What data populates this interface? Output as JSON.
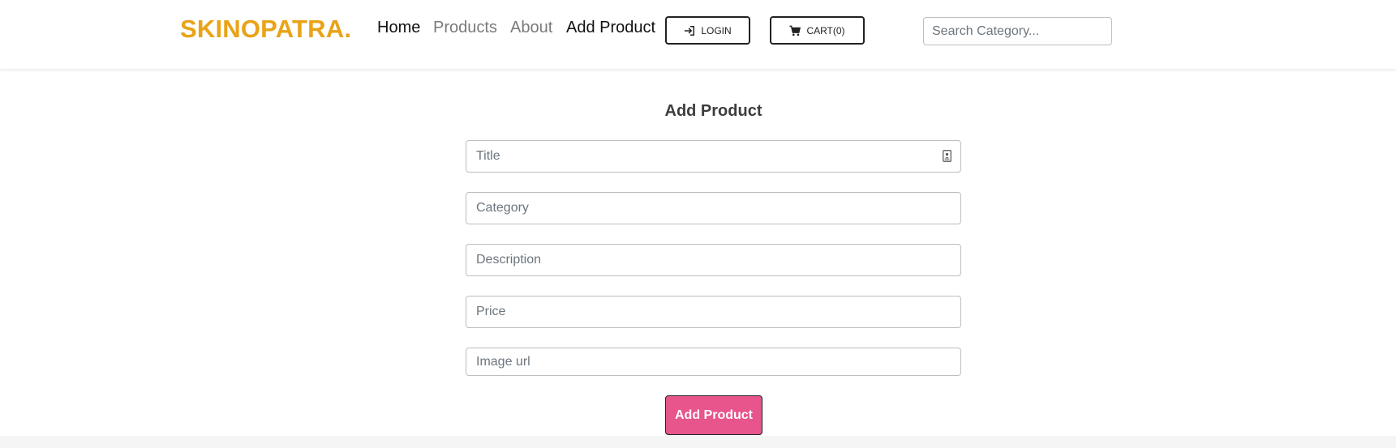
{
  "navbar": {
    "brand": "SKINOPATRA.",
    "links": [
      {
        "label": "Home",
        "active": true
      },
      {
        "label": "Products",
        "active": false
      },
      {
        "label": "About",
        "active": false
      },
      {
        "label": "Add Product",
        "active": true
      }
    ],
    "login_label": "LOGIN",
    "login_icon": "sign-in-icon",
    "cart_label": "CART(0)",
    "cart_icon": "cart-icon",
    "search_placeholder": "Search Category..."
  },
  "form": {
    "title": "Add Product",
    "fields": {
      "title": {
        "placeholder": "Title",
        "value": ""
      },
      "category": {
        "placeholder": "Category",
        "value": ""
      },
      "description": {
        "placeholder": "Description",
        "value": ""
      },
      "price": {
        "placeholder": "Price",
        "value": ""
      },
      "image_url": {
        "placeholder": "Image url",
        "value": ""
      }
    },
    "submit_label": "Add Product"
  },
  "colors": {
    "brand": "#e8a317",
    "submit_bg": "#e8548c",
    "active_link": "#111111",
    "inactive_link": "#7a7a7a"
  }
}
